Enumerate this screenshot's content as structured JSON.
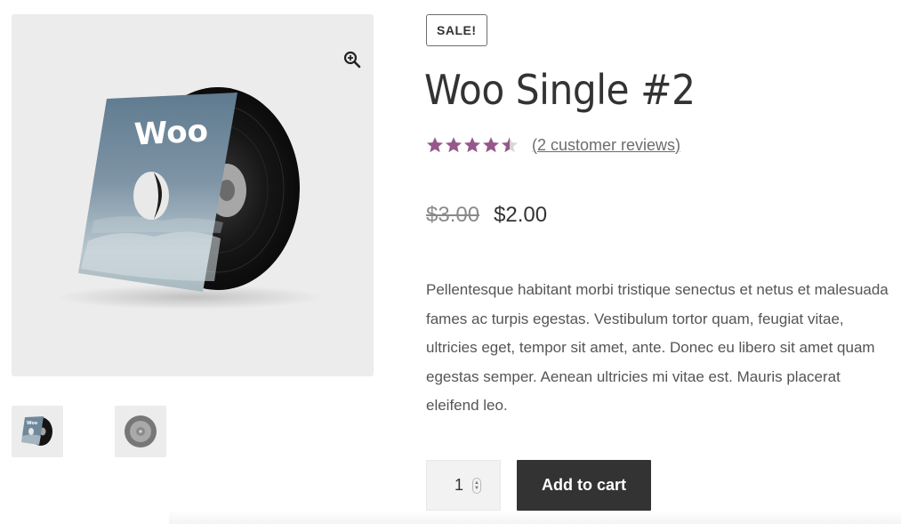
{
  "gallery": {
    "zoom_icon": "magnify-plus-icon",
    "main_image_art_text": "Woo",
    "thumbnails": [
      {
        "icon": "album-cover-thumbnail"
      },
      {
        "icon": "vinyl-record-thumbnail"
      }
    ]
  },
  "product": {
    "sale_badge": "SALE!",
    "title": "Woo Single #2",
    "rating": 4.5,
    "rating_max": 5,
    "reviews_link": "(2 customer reviews)",
    "price_old": "$3.00",
    "price_new": "$2.00",
    "description": "Pellentesque habitant morbi tristique senectus et netus et malesuada fames ac turpis egestas. Vestibulum tortor quam, feugiat vitae, ultricies eget, tempor sit amet, ante. Donec eu libero sit amet quam egestas semper. Aenean ultricies mi vitae est. Mauris placerat eleifend leo.",
    "quantity": "1",
    "add_to_cart_label": "Add to cart"
  },
  "colors": {
    "star": "#96588a",
    "button_bg": "#333333",
    "gallery_bg": "#ececec"
  }
}
